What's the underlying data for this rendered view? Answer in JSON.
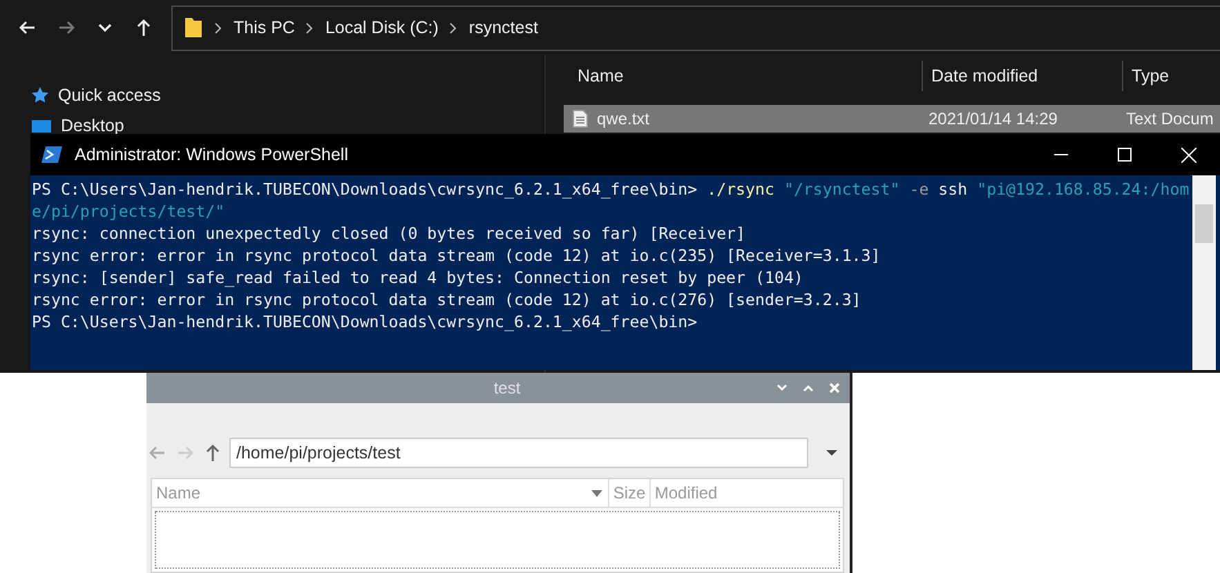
{
  "explorer": {
    "nav": [
      {
        "kind": "back",
        "disabled": false
      },
      {
        "kind": "forward",
        "disabled": true
      },
      {
        "kind": "recent",
        "disabled": false
      },
      {
        "kind": "up",
        "disabled": false
      }
    ],
    "breadcrumbs": [
      "This PC",
      "Local Disk (C:)",
      "rsynctest"
    ],
    "sidebar": {
      "items": [
        {
          "label": "Quick access",
          "kind": "star"
        },
        {
          "label": "Desktop",
          "kind": "desktop"
        }
      ]
    },
    "columns": [
      "Name",
      "Date modified",
      "Type"
    ],
    "rows": [
      {
        "name": "qwe.txt",
        "date_modified": "2021/01/14 14:29",
        "type": "Text Docum",
        "selected": true
      }
    ]
  },
  "powershell": {
    "title": "Administrator: Windows PowerShell",
    "command": [
      [
        {
          "kind": "prompt",
          "text": "PS C:\\Users\\Jan-hendrik.TUBECON\\Downloads\\cwrsync_6.2.1_x64_free\\bin>"
        },
        {
          "kind": "command",
          "text": "./rsync"
        },
        {
          "kind": "string",
          "text": "\"/rsynctest\""
        },
        {
          "kind": "parameter",
          "text": "-e"
        },
        {
          "kind": "plain",
          "text": "ssh"
        },
        {
          "kind": "string",
          "text": "\"pi@192.168.85.24:/hom"
        }
      ],
      [
        {
          "kind": "string",
          "text": "e/pi/projects/test/\""
        }
      ]
    ],
    "output": [
      "rsync: connection unexpectedly closed (0 bytes received so far) [Receiver]",
      "rsync error: error in rsync protocol data stream (code 12) at io.c(235) [Receiver=3.1.3]",
      "rsync: [sender] safe_read failed to read 4 bytes: Connection reset by peer (104)",
      "rsync error: error in rsync protocol data stream (code 12) at io.c(276) [sender=3.2.3]"
    ],
    "prompt": "PS C:\\Users\\Jan-hendrik.TUBECON\\Downloads\\cwrsync_6.2.1_x64_free\\bin>"
  },
  "file_manager": {
    "title": "test",
    "path": "/home/pi/projects/test",
    "columns": [
      "Name",
      "Size",
      "Modified"
    ]
  }
}
